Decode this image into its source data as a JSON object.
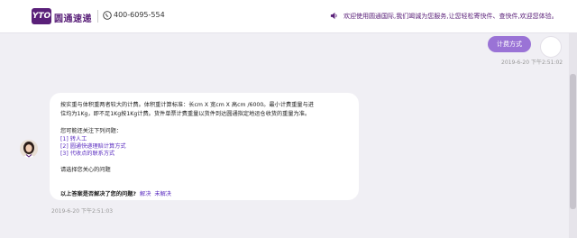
{
  "header": {
    "logo_mark": "YTO",
    "logo_text": "圆通速递",
    "phone": "400-6095-554",
    "notice": "欢迎使用圆通国际,我们竭诚为您服务,让您轻松寄快件、查快件,欢迎您体验。"
  },
  "user_message": {
    "text": "计费方式",
    "time": "2019-6-20 下午2:51:02"
  },
  "agent_message": {
    "line1": "按实重与体积重两者较大的计费。体积重计算标准：长cm X 宽cm X 高cm /6000。最小计费重量与进",
    "line2": "位均为1Kg，即不足1Kg按1Kg计费。货件单票计费重量以货件到达圆通指定地运仓收货的重量为准。",
    "prompt": "您可能还关注下列问题：",
    "questions": [
      "[1] 转人工",
      "[2] 圆通快递理赔计算方式",
      "[3] 代收点的联系方式"
    ],
    "choose": "请选择您关心的问题",
    "feedback_question": "以上答案是否解决了您的问题?",
    "resolved": "解决",
    "unresolved": "未解决",
    "time": "2019-6-20 下午2:51:03"
  },
  "colors": {
    "brand_purple": "#5a2079",
    "user_bubble": "#9a73d6",
    "link": "#5a2cc0"
  },
  "icons": {
    "phone": "phone-icon",
    "speaker": "speaker-icon",
    "agent_avatar": "agent-avatar",
    "user_avatar": "user-avatar"
  }
}
